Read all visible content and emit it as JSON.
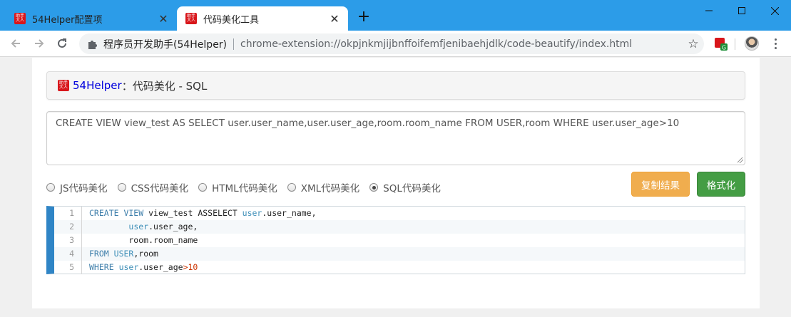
{
  "browser": {
    "tabs": [
      {
        "title": "54Helper配置项",
        "active": false
      },
      {
        "title": "代码美化工具",
        "active": true
      }
    ],
    "new_tab_label": "+",
    "favicon_text": "助手 大人",
    "window_controls": {
      "minimize_icon": "minimize-icon",
      "maximize_icon": "maximize-icon",
      "close_icon": "close-icon"
    },
    "omnibox": {
      "site_name": "程序员开发助手(54Helper)",
      "url": "chrome-extension://okpjnkmjijbnffoifemfjenibaehjdlk/code-beautify/index.html"
    },
    "colors": {
      "tab_strip": "#2c9ce8",
      "accent": "#2f85c6"
    }
  },
  "page": {
    "heading": {
      "brand": "54Helper",
      "separator": "：",
      "title": "代码美化 - SQL"
    },
    "source_text": "CREATE VIEW view_test AS SELECT user.user_name,user.user_age,room.room_name FROM USER,room WHERE user.user_age>10",
    "options": [
      {
        "label": "JS代码美化",
        "checked": false
      },
      {
        "label": "CSS代码美化",
        "checked": false
      },
      {
        "label": "HTML代码美化",
        "checked": false
      },
      {
        "label": "XML代码美化",
        "checked": false
      },
      {
        "label": "SQL代码美化",
        "checked": true
      }
    ],
    "buttons": {
      "copy": "复制结果",
      "format": "格式化"
    },
    "code": {
      "line_numbers": [
        "1",
        "2",
        "3",
        "4",
        "5"
      ],
      "lines": [
        [
          {
            "t": "CREATE VIEW",
            "c": "kw"
          },
          {
            "t": " view_test ASSELECT ",
            "c": ""
          },
          {
            "t": "user",
            "c": "ident"
          },
          {
            "t": ".user_name,",
            "c": ""
          }
        ],
        [
          {
            "t": "        ",
            "c": ""
          },
          {
            "t": "user",
            "c": "ident"
          },
          {
            "t": ".user_age,",
            "c": ""
          }
        ],
        [
          {
            "t": "        room.room_name",
            "c": ""
          }
        ],
        [
          {
            "t": "FROM",
            "c": "kw"
          },
          {
            "t": " ",
            "c": ""
          },
          {
            "t": "USER",
            "c": "ident"
          },
          {
            "t": ",room",
            "c": ""
          }
        ],
        [
          {
            "t": "WHERE",
            "c": "kw"
          },
          {
            "t": " ",
            "c": ""
          },
          {
            "t": "user",
            "c": "ident"
          },
          {
            "t": ".user_age",
            "c": ""
          },
          {
            "t": ">10",
            "c": "num"
          }
        ]
      ]
    }
  }
}
